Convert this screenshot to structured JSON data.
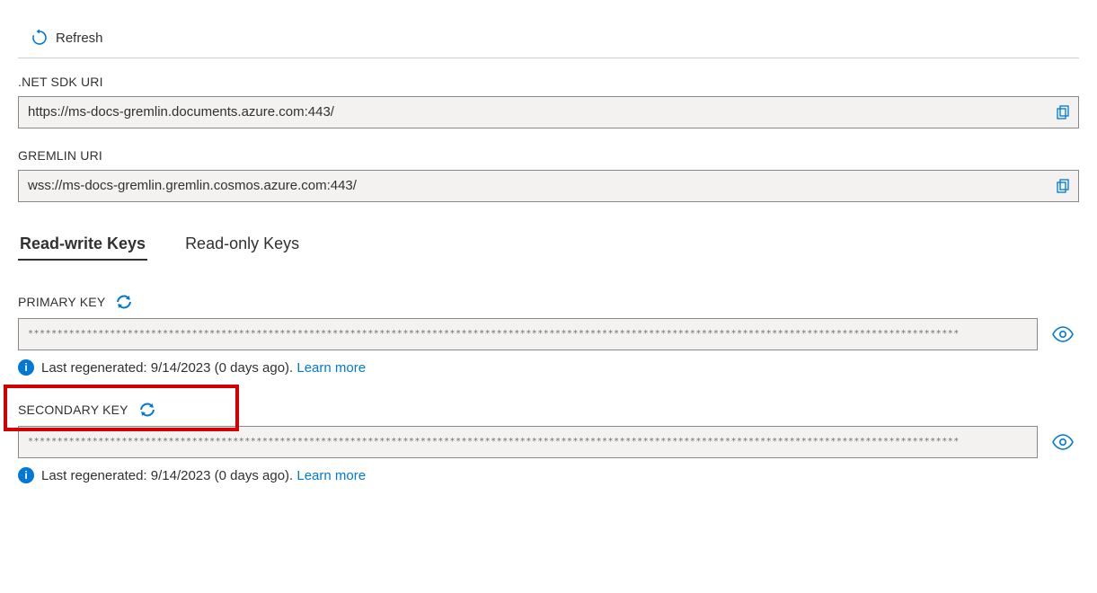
{
  "toolbar": {
    "refresh_label": "Refresh"
  },
  "uri_fields": [
    {
      "label": ".NET SDK URI",
      "value": "https://ms-docs-gremlin.documents.azure.com:443/"
    },
    {
      "label": "GREMLIN URI",
      "value": "wss://ms-docs-gremlin.gremlin.cosmos.azure.com:443/"
    }
  ],
  "tabs": [
    {
      "label": "Read-write Keys",
      "active": true
    },
    {
      "label": "Read-only Keys",
      "active": false
    }
  ],
  "keys": {
    "primary": {
      "label": "PRIMARY KEY",
      "masked_value": "***************************************************************************************************************************************************************",
      "regen_text": "Last regenerated: 9/14/2023 (0 days ago). ",
      "learn_more": "Learn more"
    },
    "secondary": {
      "label": "SECONDARY KEY",
      "masked_value": "***************************************************************************************************************************************************************",
      "regen_text": "Last regenerated: 9/14/2023 (0 days ago). ",
      "learn_more": "Learn more"
    }
  },
  "colors": {
    "accent": "#0078d4",
    "highlight": "#d40000"
  }
}
